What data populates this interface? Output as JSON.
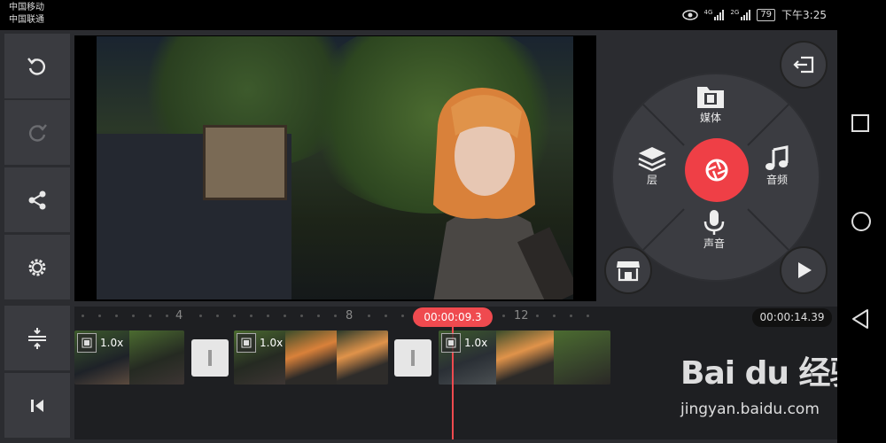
{
  "status_bar": {
    "carrier1": "中国移动",
    "carrier2": "中国联通",
    "net1": "4G",
    "net2": "2G",
    "battery": "79",
    "time": "下午3:25"
  },
  "left_toolbar": {
    "items": [
      {
        "name": "undo",
        "icon": "undo-icon"
      },
      {
        "name": "redo",
        "icon": "redo-icon"
      },
      {
        "name": "share",
        "icon": "share-icon"
      },
      {
        "name": "settings",
        "icon": "gear-icon"
      },
      {
        "name": "track-layout",
        "icon": "tracks-icon"
      },
      {
        "name": "go-to-start",
        "icon": "skip-start-icon"
      }
    ]
  },
  "wheel_menu": {
    "media_label": "媒体",
    "layer_label": "层",
    "audio_label": "音频",
    "voice_label": "声音"
  },
  "timeline": {
    "ruler_labels": [
      "4",
      "8",
      "12"
    ],
    "playhead_time": "00:00:09.3",
    "total_time": "00:00:14.39",
    "clips": [
      {
        "speed": "1.0x"
      },
      {
        "speed": "1.0x"
      },
      {
        "speed": "1.0x"
      }
    ]
  },
  "watermark": {
    "logo": "Bai du 经验",
    "url": "jingyan.baidu.com"
  },
  "colors": {
    "accent": "#ef3f46",
    "panel": "#3b3c41",
    "background": "#2b2c30"
  }
}
